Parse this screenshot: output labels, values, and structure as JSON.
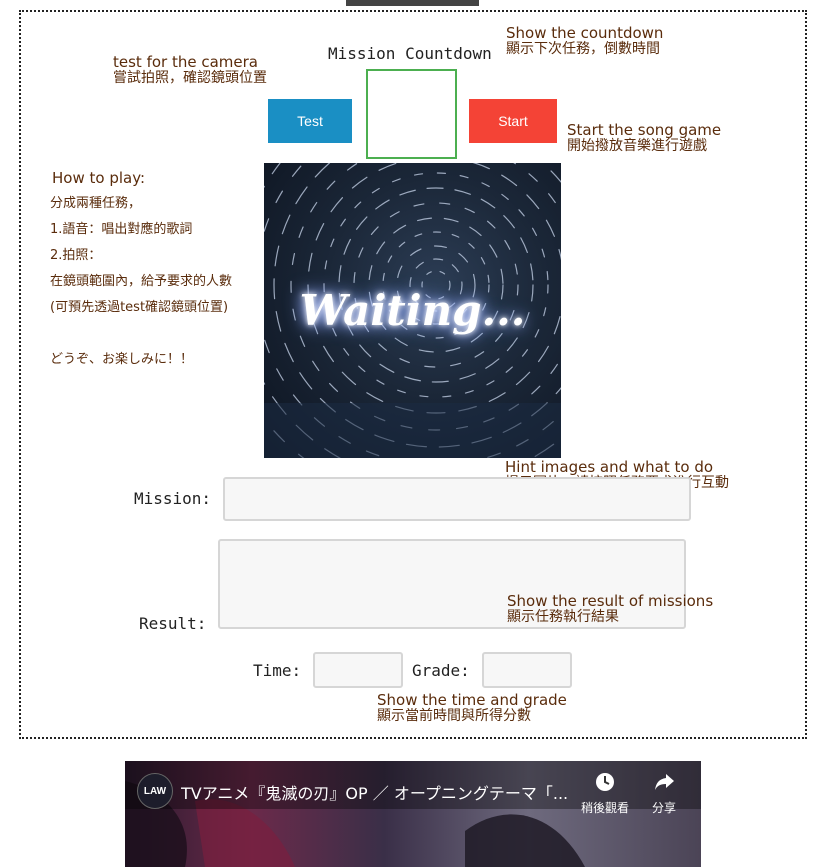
{
  "countdown": {
    "title": "Mission Countdown"
  },
  "buttons": {
    "test": "Test",
    "start": "Start"
  },
  "annotations": {
    "camera_en": "test for the camera",
    "camera_zh": "嘗試拍照，確認鏡頭位置",
    "countdown_en": "Show the countdown",
    "countdown_zh": "顯示下次任務，倒數時間",
    "start_en": "Start the song game",
    "start_zh": "開始撥放音樂進行遊戲",
    "hint_en": "Hint images and what to do",
    "hint_zh": "提示圖片，請按照任務要求進行互動",
    "result_en": "Show the result of missions",
    "result_zh": "顯示任務執行結果",
    "time_en": "Show the time and grade",
    "time_zh": "顯示當前時間與所得分數"
  },
  "howto": {
    "title": "How to play:",
    "line1": "分成兩種任務，",
    "line2": "1.語音：唱出對應的歌詞",
    "line3": "2.拍照：",
    "line4": "在鏡頭範圍內，給予要求的人數",
    "line5": "(可預先透過test確認鏡頭位置)",
    "line6": "どうぞ、お楽しみに！！"
  },
  "image": {
    "waiting_text": "Waiting..."
  },
  "fields": {
    "mission_label": "Mission:",
    "result_label": "Result:",
    "time_label": "Time:",
    "grade_label": "Grade:"
  },
  "video": {
    "channel_logo": "LAW",
    "title": "TVアニメ『鬼滅の刃』OP ／ オープニングテーマ「...",
    "watch_later": "稍後觀看",
    "share": "分享"
  },
  "colors": {
    "test_button": "#1a8fc4",
    "start_button": "#f44336",
    "countdown_border": "#4caf50",
    "annotation_text": "#5a2c0c"
  }
}
